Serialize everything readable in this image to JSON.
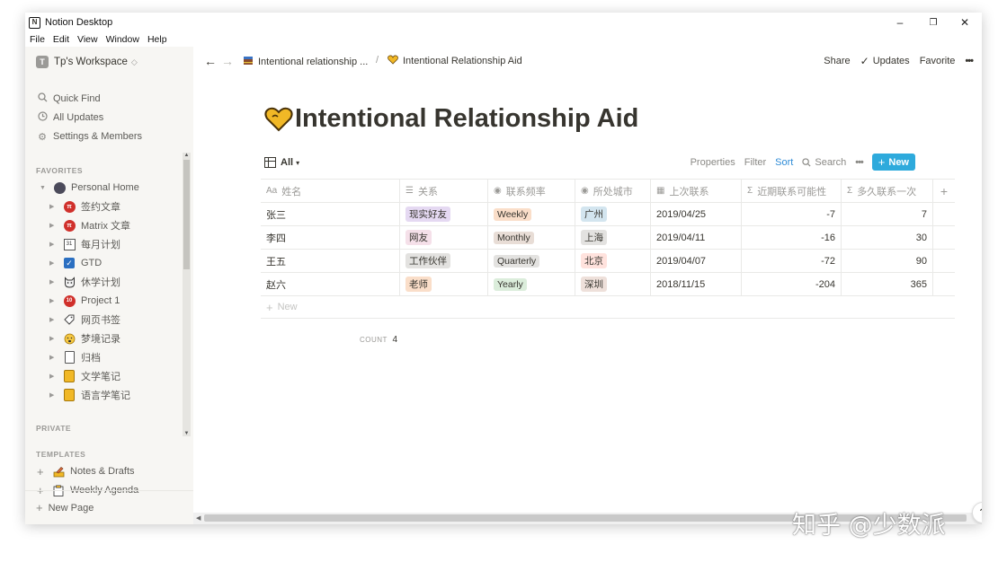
{
  "window": {
    "title": "Notion Desktop",
    "controls": {
      "minimize": "–",
      "maximize": "❐",
      "close": "✕"
    }
  },
  "menu": [
    "File",
    "Edit",
    "View",
    "Window",
    "Help"
  ],
  "sidebar": {
    "workspace": {
      "badge": "T",
      "name": "Tp's Workspace",
      "switcher": "◇"
    },
    "actions": [
      {
        "icon": "search-icon",
        "glyph": "🔍",
        "label": "Quick Find"
      },
      {
        "icon": "clock-icon",
        "glyph": "◷",
        "label": "All Updates"
      },
      {
        "icon": "gear-icon",
        "glyph": "⚙",
        "label": "Settings & Members"
      }
    ],
    "favorites_label": "FAVORITES",
    "favorites_root": {
      "label": "Personal Home"
    },
    "favorites": [
      {
        "label": "签约文章",
        "icon": "red-circle-icon"
      },
      {
        "label": "Matrix 文章",
        "icon": "red-circle-icon"
      },
      {
        "label": "每月计划",
        "icon": "calendar-icon"
      },
      {
        "label": "GTD",
        "icon": "checkbox-icon"
      },
      {
        "label": "休学计划",
        "icon": "cat-icon"
      },
      {
        "label": "Project 1",
        "icon": "badge-icon"
      },
      {
        "label": "网页书签",
        "icon": "tag-icon"
      },
      {
        "label": "梦境记录",
        "icon": "face-icon"
      },
      {
        "label": "归档",
        "icon": "phone-icon"
      },
      {
        "label": "文学笔记",
        "icon": "notebook-icon"
      },
      {
        "label": "语言学笔记",
        "icon": "notebook-icon"
      }
    ],
    "private_label": "PRIVATE",
    "templates_label": "TEMPLATES",
    "templates": [
      {
        "label": "Notes & Drafts",
        "icon": "pencil-icon"
      },
      {
        "label": "Weekly Agenda",
        "icon": "clipboard-icon"
      }
    ],
    "new_page": "New Page"
  },
  "topbar": {
    "breadcrumbs": [
      {
        "label": "Intentional relationship ...",
        "icon": "book-icon"
      },
      {
        "label": "Intentional Relationship Aid",
        "icon": "heart-icon"
      }
    ],
    "separator": "/",
    "share": "Share",
    "updates": "Updates",
    "favorite": "Favorite",
    "more": "•••"
  },
  "page": {
    "title": "Intentional Relationship Aid"
  },
  "view": {
    "name": "All",
    "properties": "Properties",
    "filter": "Filter",
    "sort": "Sort",
    "search": "Search",
    "more": "•••",
    "new_button": "New"
  },
  "table": {
    "columns": [
      {
        "icon": "Aa",
        "label": "姓名"
      },
      {
        "icon": "☰",
        "label": "关系"
      },
      {
        "icon": "◉",
        "label": "联系频率"
      },
      {
        "icon": "◉",
        "label": "所处城市"
      },
      {
        "icon": "▦",
        "label": "上次联系"
      },
      {
        "icon": "Σ",
        "label": "近期联系可能性"
      },
      {
        "icon": "Σ",
        "label": "多久联系一次"
      }
    ],
    "add_column": "+",
    "rows": [
      {
        "name": "张三",
        "relation": "现实好友",
        "relation_color": "#e5d9f2",
        "frequency": "Weekly",
        "frequency_color": "#fadec9",
        "city": "广州",
        "city_color": "#d3e5ef",
        "last_contact": "2019/04/25",
        "likelihood": "-7",
        "interval": "7"
      },
      {
        "name": "李四",
        "relation": "网友",
        "relation_color": "#f5e0e9",
        "frequency": "Monthly",
        "frequency_color": "#e8ddd6",
        "city": "上海",
        "city_color": "#e3e2e0",
        "last_contact": "2019/04/11",
        "likelihood": "-16",
        "interval": "30"
      },
      {
        "name": "王五",
        "relation": "工作伙伴",
        "relation_color": "#e3e2e0",
        "frequency": "Quarterly",
        "frequency_color": "#e3e2e0",
        "city": "北京",
        "city_color": "#ffe2dd",
        "last_contact": "2019/04/07",
        "likelihood": "-72",
        "interval": "90"
      },
      {
        "name": "赵六",
        "relation": "老师",
        "relation_color": "#fadec9",
        "frequency": "Yearly",
        "frequency_color": "#dbeddb",
        "city": "深圳",
        "city_color": "#eee0da",
        "last_contact": "2018/11/15",
        "likelihood": "-204",
        "interval": "365"
      }
    ],
    "new_row": "New",
    "count_label": "COUNT",
    "count_value": "4"
  },
  "help": "?",
  "watermark": "知乎 @少数派"
}
